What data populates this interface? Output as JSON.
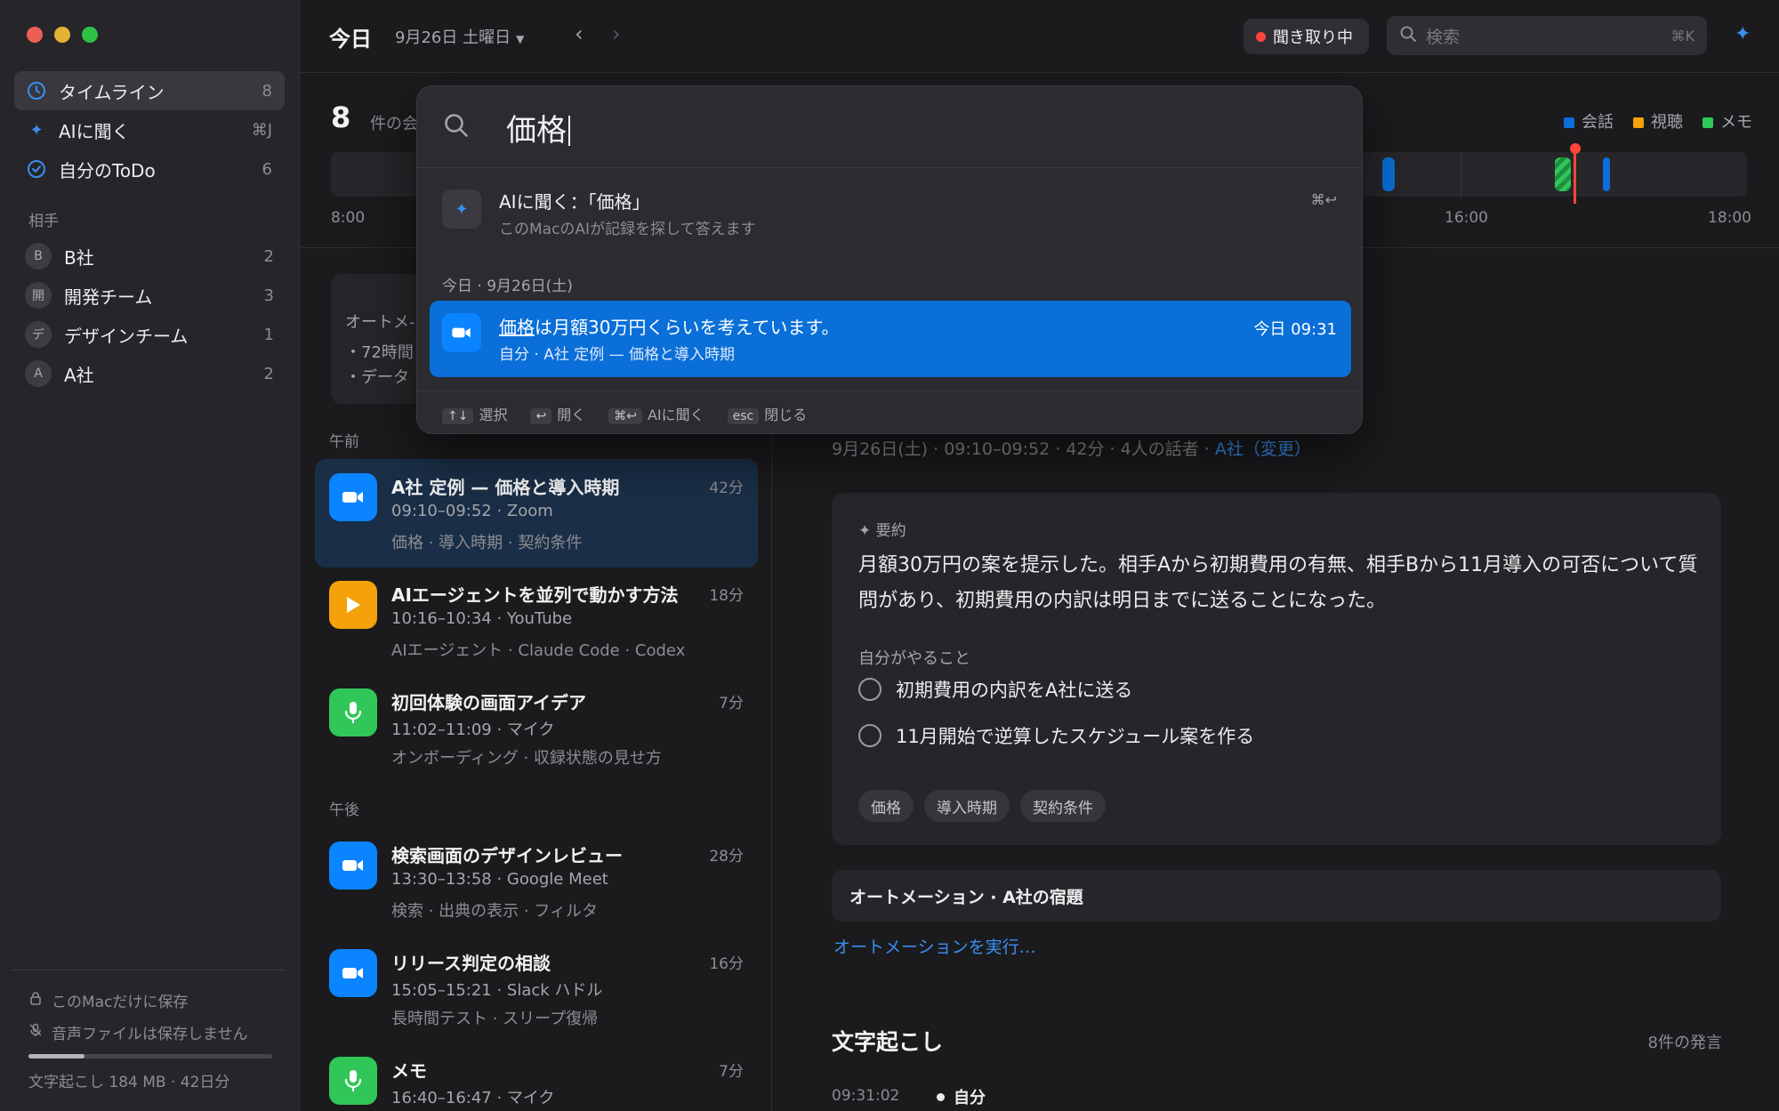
{
  "sidebar": {
    "nav": [
      {
        "label": "タイムライン",
        "count": "8"
      },
      {
        "label": "AIに聞く",
        "count": "⌘J"
      },
      {
        "label": "自分のToDo",
        "count": "6"
      }
    ],
    "section_label": "相手",
    "contacts": [
      {
        "initial": "B",
        "label": "B社",
        "count": "2"
      },
      {
        "initial": "開",
        "label": "開発チーム",
        "count": "3"
      },
      {
        "initial": "デ",
        "label": "デザインチーム",
        "count": "1"
      },
      {
        "initial": "A",
        "label": "A社",
        "count": "2"
      }
    ],
    "footer": {
      "local_only": "このMacだけに保存",
      "no_audio": "音声ファイルは保存しません",
      "storage": "文字起こし 184 MB · 42日分",
      "storage_fraction": 0.23
    }
  },
  "topbar": {
    "title": "今日",
    "date": "9月26日 土曜日",
    "recording_label": "聞き取り中",
    "search_placeholder": "検索",
    "search_shortcut": "⌘K"
  },
  "strip": {
    "count": "8",
    "count_label": "件の会",
    "legend": [
      {
        "label": "会話",
        "color": "#0a6fd8"
      },
      {
        "label": "視聴",
        "color": "#f5a10a"
      },
      {
        "label": "メモ",
        "color": "#30c758"
      }
    ],
    "ticks": [
      "8:00",
      "16:00",
      "18:00"
    ]
  },
  "list": {
    "automation_card": {
      "title": "オートメ-",
      "lines": [
        "・72時間",
        "・データ"
      ]
    },
    "period_am": "午前",
    "period_pm": "午後",
    "recordings": [
      {
        "title": "A社 定例 — 価格と導入時期",
        "duration": "42分",
        "time": "09:10–09:52 · Zoom",
        "tags": "価格 · 導入時期 · 契約条件",
        "icon": "video-icon"
      },
      {
        "title": "AIエージェントを並列で動かす方法",
        "duration": "18分",
        "time": "10:16–10:34 · YouTube",
        "tags": "AIエージェント · Claude Code · Codex",
        "icon": "play-icon"
      },
      {
        "title": "初回体験の画面アイデア",
        "duration": "7分",
        "time": "11:02–11:09 · マイク",
        "tags": "オンボーディング · 収録状態の見せ方",
        "icon": "mic-icon"
      },
      {
        "title": "検索画面のデザインレビュー",
        "duration": "28分",
        "time": "13:30–13:58 · Google Meet",
        "tags": "検索 · 出典の表示 · フィルタ",
        "icon": "video-icon"
      },
      {
        "title": "リリース判定の相談",
        "duration": "16分",
        "time": "15:05–15:21 · Slack ハドル",
        "tags": "長時間テスト · スリープ復帰",
        "icon": "video-icon"
      },
      {
        "title": "メモ",
        "duration": "7分",
        "time": "16:40–16:47 · マイク",
        "tags": "",
        "icon": "mic-icon"
      }
    ]
  },
  "detail": {
    "meta_text": "9月26日(土) · 09:10–09:52 · 42分 · 4人の話者 · ",
    "meta_company": "A社",
    "meta_change": "（変更）",
    "summary_label": "要約",
    "summary_text": "月額30万円の案を提示した。相手Aから初期費用の有無、相手Bから11月導入の可否について質問があり、初期費用の内訳は明日までに送ることになった。",
    "todo_label": "自分がやること",
    "todos": [
      "初期費用の内訳をA社に送る",
      "11月開始で逆算したスケジュール案を作る"
    ],
    "tags": [
      "価格",
      "導入時期",
      "契約条件"
    ],
    "automation": "オートメーション · A社の宿題",
    "automation_link": "オートメーションを実行…",
    "transcript_title": "文字起こし",
    "transcript_count": "8件の発言",
    "first_utterance": {
      "time": "09:31:02",
      "speaker": "自分"
    }
  },
  "palette": {
    "query": "価格",
    "ai_title": "AIに聞く：「価格」",
    "ai_subtitle": "このMacのAIが記録を探して答えます",
    "ai_shortcut": "⌘↩",
    "group_label": "今日 · 9月26日(土)",
    "result": {
      "highlight": "価格",
      "rest": "は月額30万円くらいを考えています。",
      "subtitle": "自分 · A社 定例 — 価格と導入時期",
      "when": "今日 09:31"
    },
    "footer": [
      {
        "key": "↑↓",
        "label": "選択"
      },
      {
        "key": "↩",
        "label": "開く"
      },
      {
        "key": "⌘↩",
        "label": "AIに聞く"
      },
      {
        "key": "esc",
        "label": "閉じる"
      }
    ]
  }
}
